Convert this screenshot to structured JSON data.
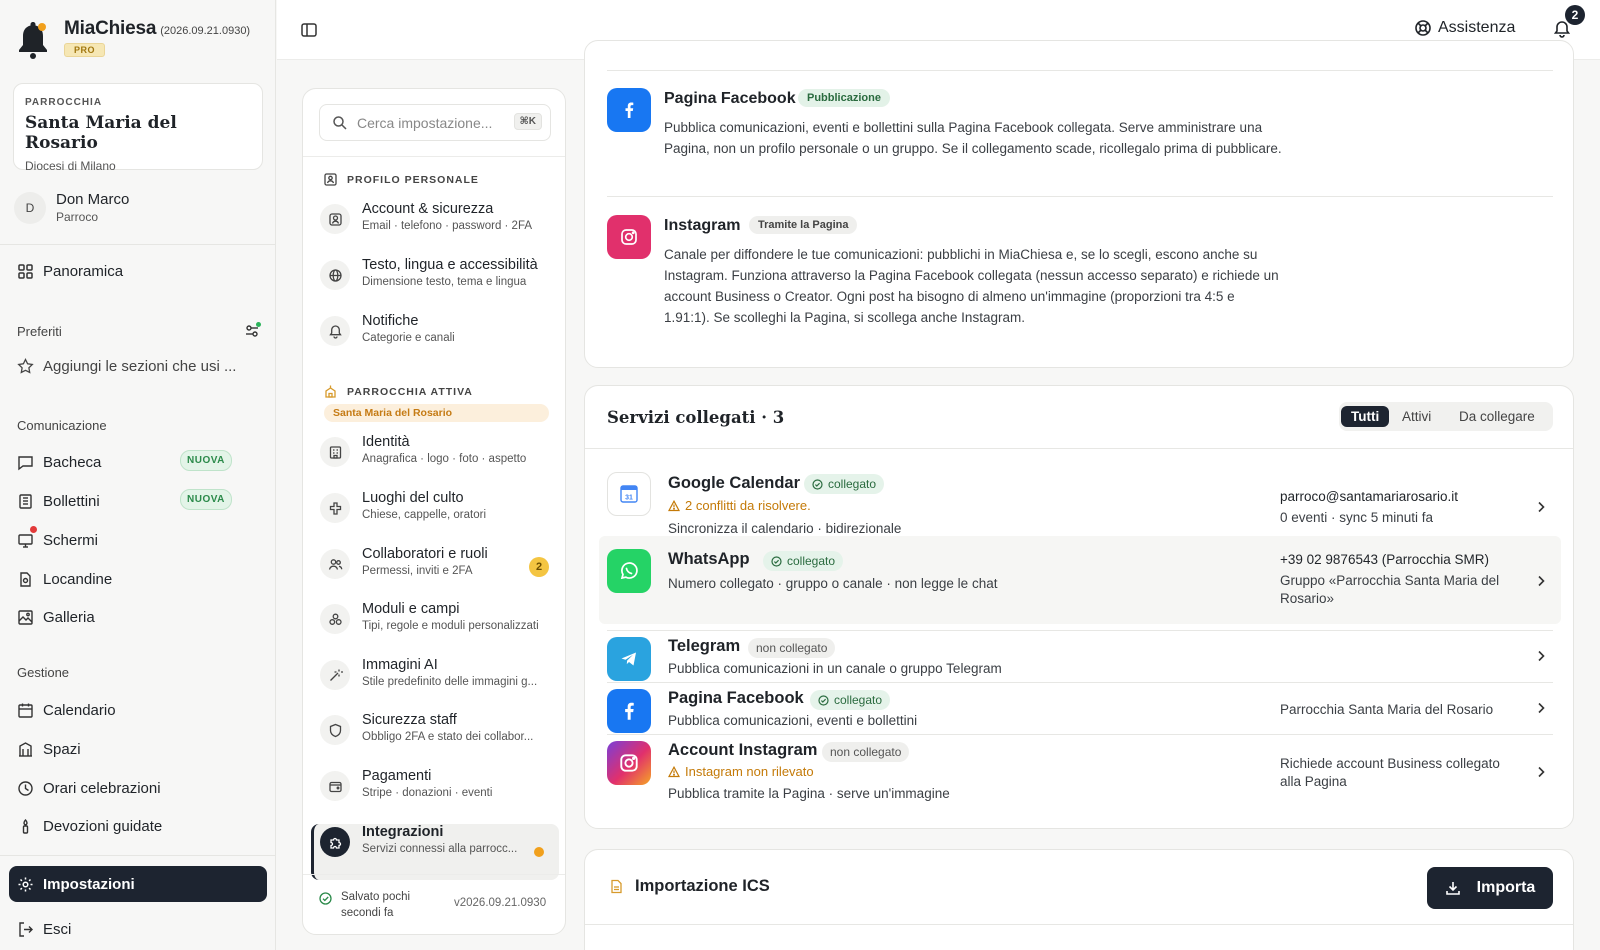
{
  "app": {
    "name": "MiaChiesa",
    "version": "(2026.09.21.0930)",
    "tier": "PRO"
  },
  "parish": {
    "label": "PARROCCHIA",
    "name": "Santa Maria del Rosario",
    "diocese": "Diocesi di Milano"
  },
  "user": {
    "initial": "D",
    "name": "Don Marco",
    "role": "Parroco"
  },
  "sidebar": {
    "overview": "Panoramica",
    "favorites_label": "Preferiti",
    "favorites_hint": "Aggiungi le sezioni che usi ...",
    "comm_label": "Comunicazione",
    "comm": [
      {
        "label": "Bacheca",
        "badge": "NUOVA"
      },
      {
        "label": "Bollettini",
        "badge": "NUOVA"
      },
      {
        "label": "Schermi"
      },
      {
        "label": "Locandine"
      },
      {
        "label": "Galleria"
      }
    ],
    "mgmt_label": "Gestione",
    "mgmt": [
      {
        "label": "Calendario"
      },
      {
        "label": "Spazi"
      },
      {
        "label": "Orari celebrazioni"
      },
      {
        "label": "Devozioni guidate"
      }
    ],
    "settings": "Impostazioni",
    "logout": "Esci"
  },
  "topbar": {
    "help": "Assistenza",
    "notifications": "2"
  },
  "settings_panel": {
    "search_placeholder": "Cerca impostazione...",
    "search_shortcut": "⌘K",
    "group_personal": "PROFILO PERSONALE",
    "group_parish": "PARROCCHIA ATTIVA",
    "group_parish_name": "Santa Maria del Rosario",
    "personal": [
      {
        "title": "Account & sicurezza",
        "desc": "Email · telefono · password · 2FA"
      },
      {
        "title": "Testo, lingua e accessibilità",
        "desc": "Dimensione testo, tema e lingua"
      },
      {
        "title": "Notifiche",
        "desc": "Categorie e canali"
      }
    ],
    "parish_items": [
      {
        "title": "Identità",
        "desc": "Anagrafica · logo · foto · aspetto"
      },
      {
        "title": "Luoghi del culto",
        "desc": "Chiese, cappelle, oratori"
      },
      {
        "title": "Collaboratori e ruoli",
        "desc": "Permessi, inviti e 2FA",
        "count": "2"
      },
      {
        "title": "Moduli e campi",
        "desc": "Tipi, regole e moduli personalizzati"
      },
      {
        "title": "Immagini AI",
        "desc": "Stile predefinito delle immagini g..."
      },
      {
        "title": "Sicurezza staff",
        "desc": "Obbligo 2FA e stato dei collabor..."
      },
      {
        "title": "Pagamenti",
        "desc": "Stripe · donazioni · eventi"
      },
      {
        "title": "Integrazioni",
        "desc": "Servizi connessi alla parrocc..."
      }
    ],
    "saved": "Salvato pochi secondi fa",
    "saved_line1": "Salvato pochi",
    "saved_line2": "secondi fa",
    "version": "v2026.09.21.0930"
  },
  "publish_card": {
    "facebook": {
      "title": "Pagina Facebook",
      "chip": "Pubblicazione",
      "desc": "Pubblica comunicazioni, eventi e bollettini sulla Pagina Facebook collegata. Serve amministrare una Pagina, non un profilo personale o un gruppo. Se il collegamento scade, ricollegalo prima di pubblicare."
    },
    "instagram": {
      "title": "Instagram",
      "chip": "Tramite la Pagina",
      "desc": "Canale per diffondere le tue comunicazioni: pubblichi in MiaChiesa e, se lo scegli, escono anche su Instagram. Funziona attraverso la Pagina Facebook collegata (nessun accesso separato) e richiede un account Business o Creator. Ogni post ha bisogno di almeno un'immagine (proporzioni tra 4:5 e 1.91:1). Se scolleghi la Pagina, si scollega anche Instagram."
    }
  },
  "services": {
    "title": "Servizi collegati · 3",
    "filters": [
      "Tutti",
      "Attivi",
      "Da collegare"
    ],
    "items": [
      {
        "name": "Google Calendar",
        "status": "collegato",
        "warning": "2 conflitti da risolvere.",
        "desc": "Sincronizza il calendario · bidirezionale",
        "right1": "parroco@santamariarosario.it",
        "right2": "0 eventi · sync 5 minuti fa"
      },
      {
        "name": "WhatsApp",
        "status": "collegato",
        "desc": "Numero collegato · gruppo o canale · non legge le chat",
        "right1": "+39 02 9876543 (Parrocchia SMR)",
        "right2": "Gruppo «Parrocchia Santa Maria del Rosario»"
      },
      {
        "name": "Telegram",
        "status": "non collegato",
        "desc": "Pubblica comunicazioni in un canale o gruppo Telegram"
      },
      {
        "name": "Pagina Facebook",
        "status": "collegato",
        "desc": "Pubblica comunicazioni, eventi e bollettini",
        "right2": "Parrocchia Santa Maria del Rosario"
      },
      {
        "name": "Account Instagram",
        "status": "non collegato",
        "warning": "Instagram non rilevato",
        "desc": "Pubblica tramite la Pagina · serve un'immagine",
        "right2": "Richiede account Business collegato alla Pagina"
      }
    ]
  },
  "ics": {
    "title": "Importazione ICS",
    "button": "Importa"
  },
  "colors": {
    "dark": "#1d2430",
    "facebook": "#1877f2",
    "instagram": "#e1306c",
    "whatsapp": "#25d366",
    "telegram": "#2aa3df",
    "success": "#2b8a4a",
    "warning": "#c47a08"
  }
}
